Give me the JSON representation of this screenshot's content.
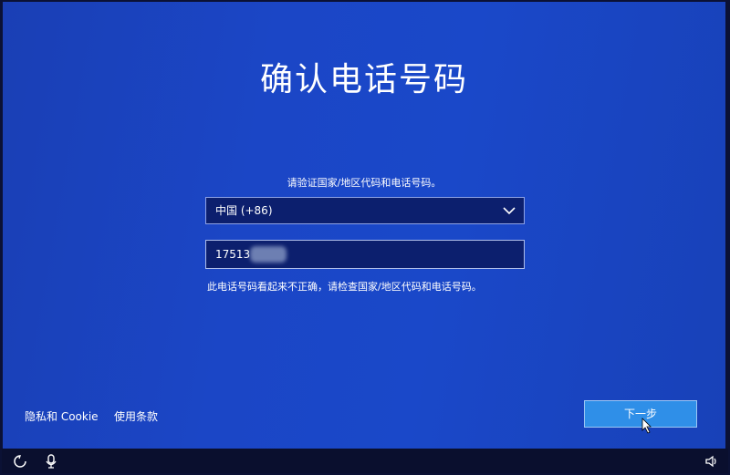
{
  "page": {
    "title": "确认电话号码",
    "instruction": "请验证国家/地区代码和电话号码。",
    "error_message": "此电话号码看起来不正确，请检查国家/地区代码和电话号码。"
  },
  "country_select": {
    "selected": "中国 (+86)",
    "icon": "chevron-down-icon"
  },
  "phone_input": {
    "value": "17513"
  },
  "footer_links": {
    "privacy": "隐私和 Cookie",
    "terms": "使用条款"
  },
  "buttons": {
    "next_label": "下一步"
  },
  "taskbar": {
    "left_icons": [
      "ease-of-access-icon",
      "microphone-icon"
    ],
    "right_icons": [
      "volume-icon"
    ]
  },
  "colors": {
    "background": "#1b46c6",
    "field_bg": "#0c1f6e",
    "button_bg": "#2f8fe8",
    "taskbar_bg": "#0a0f2e"
  }
}
